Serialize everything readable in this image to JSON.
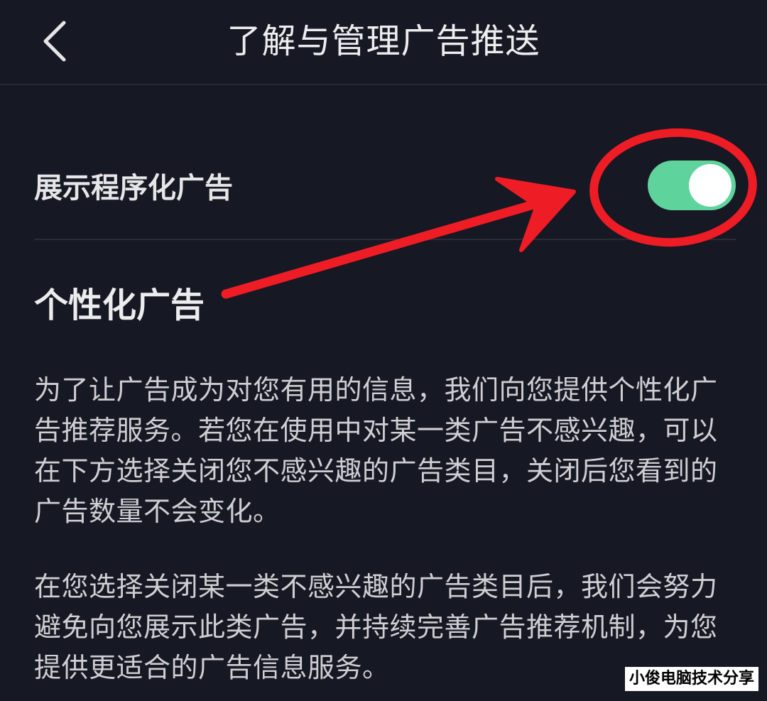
{
  "header": {
    "title": "了解与管理广告推送",
    "back_icon": "chevron-left-icon"
  },
  "settings": {
    "programmatic_ads": {
      "label": "展示程序化广告",
      "enabled": true,
      "on_color": "#5fd39c"
    }
  },
  "section": {
    "heading": "个性化广告",
    "paragraphs": [
      "为了让广告成为对您有用的信息，我们向您提供个性化广告推荐服务。若您在使用中对某一类广告不感兴趣，可以在下方选择关闭您不感兴趣的广告类目，关闭后您看到的广告数量不会变化。",
      "在您选择关闭某一类不感兴趣的广告类目后，我们会努力避免向您展示此类广告，并持续完善广告推荐机制，为您提供更适合的广告信息服务。"
    ]
  },
  "annotation": {
    "color": "#ee1c24"
  },
  "watermark": {
    "text": "小俊电脑技术分享"
  },
  "theme": {
    "background": "#161823"
  }
}
